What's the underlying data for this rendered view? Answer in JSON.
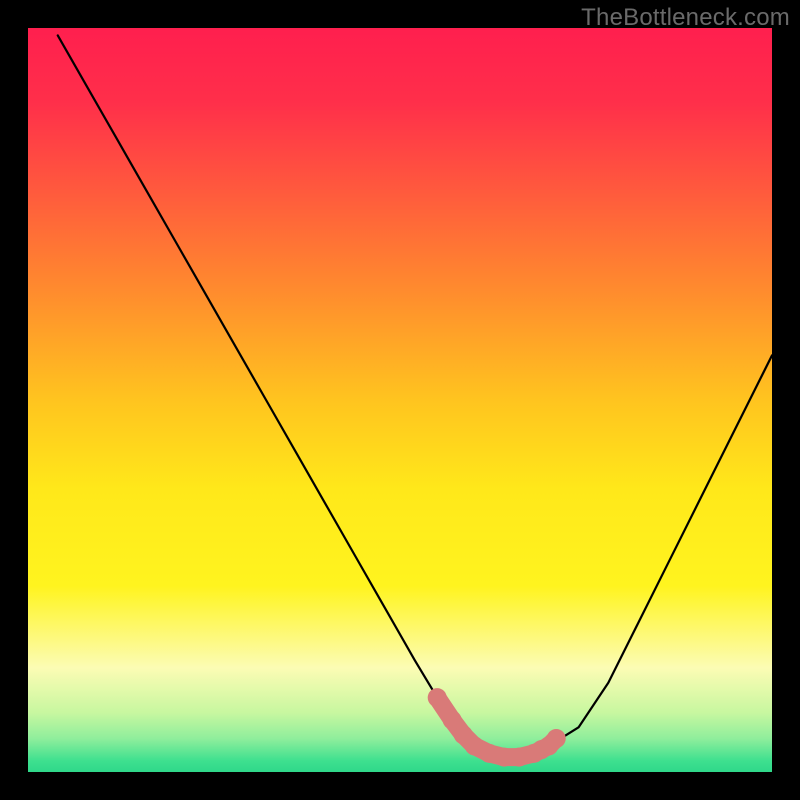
{
  "watermark": "TheBottleneck.com",
  "colors": {
    "gradient_stops": [
      {
        "offset": 0.0,
        "color": "#ff1f4e"
      },
      {
        "offset": 0.1,
        "color": "#ff2f4a"
      },
      {
        "offset": 0.22,
        "color": "#ff5a3d"
      },
      {
        "offset": 0.35,
        "color": "#ff8a2e"
      },
      {
        "offset": 0.5,
        "color": "#ffc41f"
      },
      {
        "offset": 0.62,
        "color": "#ffe81a"
      },
      {
        "offset": 0.75,
        "color": "#fff41f"
      },
      {
        "offset": 0.86,
        "color": "#fcfcb4"
      },
      {
        "offset": 0.92,
        "color": "#c8f7a0"
      },
      {
        "offset": 0.955,
        "color": "#8fee9c"
      },
      {
        "offset": 0.985,
        "color": "#3ee08f"
      },
      {
        "offset": 1.0,
        "color": "#2fd88a"
      }
    ],
    "curve": "#000000",
    "marker_fill": "#d97a78",
    "marker_stroke": "#b95a58",
    "frame": "#000000"
  },
  "chart_data": {
    "type": "line",
    "title": "",
    "xlabel": "",
    "ylabel": "",
    "xlim": [
      0,
      100
    ],
    "ylim": [
      0,
      100
    ],
    "series": [
      {
        "name": "bottleneck-curve",
        "x": [
          4,
          8,
          12,
          16,
          20,
          24,
          28,
          32,
          36,
          40,
          44,
          48,
          52,
          55,
          58,
          60,
          62,
          64,
          66,
          68,
          70,
          74,
          78,
          82,
          86,
          90,
          94,
          98,
          100
        ],
        "y": [
          99,
          92,
          85,
          78,
          71,
          64,
          57,
          50,
          43,
          36,
          29,
          22,
          15,
          10,
          6,
          4,
          2.5,
          2,
          2,
          2.5,
          3.5,
          6,
          12,
          20,
          28,
          36,
          44,
          52,
          56
        ]
      }
    ],
    "markers": {
      "name": "optimal-range",
      "points": [
        {
          "x": 55,
          "y": 10
        },
        {
          "x": 57,
          "y": 7
        },
        {
          "x": 58.5,
          "y": 5
        },
        {
          "x": 60,
          "y": 3.5
        },
        {
          "x": 62,
          "y": 2.5
        },
        {
          "x": 64,
          "y": 2
        },
        {
          "x": 66,
          "y": 2
        },
        {
          "x": 68,
          "y": 2.5
        },
        {
          "x": 69,
          "y": 3
        },
        {
          "x": 70,
          "y": 3.5
        },
        {
          "x": 71,
          "y": 4.5
        }
      ]
    }
  }
}
